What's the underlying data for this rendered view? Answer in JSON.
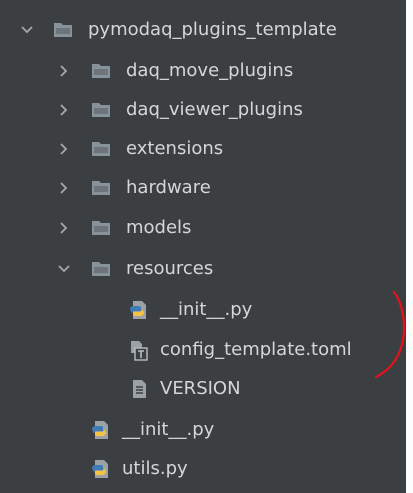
{
  "colors": {
    "panel_bg": "#3c3f41",
    "text": "#d6d6d6",
    "folder_blue": "#87939a",
    "chevron": "#a8a8a8",
    "python_blue": "#3f7cb5",
    "python_yellow": "#f5c342",
    "annotation_red": "#e8101a"
  },
  "tree": {
    "root": {
      "label": "pymodaq_plugins_template",
      "state": "expanded",
      "icon": "folder-icon"
    },
    "items": [
      {
        "label": "daq_move_plugins",
        "state": "collapsed",
        "icon": "folder-icon"
      },
      {
        "label": "daq_viewer_plugins",
        "state": "collapsed",
        "icon": "folder-icon"
      },
      {
        "label": "extensions",
        "state": "collapsed",
        "icon": "folder-icon"
      },
      {
        "label": "hardware",
        "state": "collapsed",
        "icon": "folder-icon"
      },
      {
        "label": "models",
        "state": "collapsed",
        "icon": "folder-icon"
      },
      {
        "label": "resources",
        "state": "expanded",
        "icon": "folder-icon"
      },
      {
        "label": "__init__.py",
        "icon": "python-file-icon"
      },
      {
        "label": "config_template.toml",
        "icon": "toml-file-icon"
      },
      {
        "label": "VERSION",
        "icon": "text-file-icon"
      },
      {
        "label": "__init__.py",
        "icon": "python-file-icon"
      },
      {
        "label": "utils.py",
        "icon": "python-file-icon"
      }
    ]
  }
}
